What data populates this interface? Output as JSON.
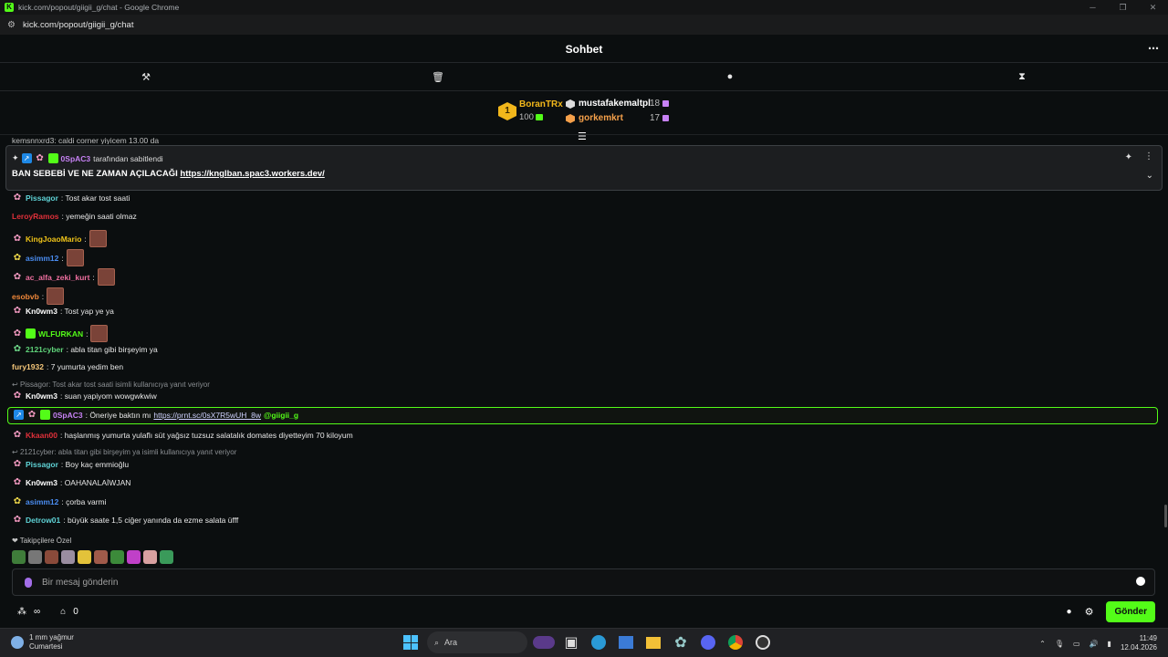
{
  "window": {
    "title": "kick.com/popout/giigii_g/chat - Google Chrome",
    "url": "kick.com/popout/giigii_g/chat",
    "controls": [
      "─",
      "❐",
      "✕"
    ]
  },
  "chat": {
    "title": "Sohbet",
    "more": "⋯"
  },
  "leaderboard": {
    "first": {
      "rank": "1",
      "name": "BoranTRx",
      "value": "100"
    },
    "second": {
      "name": "mustafakemaltpl",
      "value": "18"
    },
    "third": {
      "name": "gorkemkrt",
      "value": "17"
    }
  },
  "pinned": {
    "by_user": "0SpAC3",
    "by_text": "tarafından sabitlendi",
    "text": "BAN SEBEBİ VE NE ZAMAN AÇILACAĞI ",
    "link": "https://knglban.spac3.workers.dev/"
  },
  "messages": [
    {
      "user": "Pissagor",
      "color": "#5fd3d6",
      "text": ": Tost akar tost saati"
    },
    {
      "user": "LeroyRamos",
      "color": "#e0303a",
      "text": ": yemeğin saati olmaz"
    },
    {
      "user": "KingJoaoMario",
      "color": "#f0c419",
      "text": ":"
    },
    {
      "user": "asimm12",
      "color": "#4a8cf0",
      "text": ":"
    },
    {
      "user": "ac_alfa_zeki_kurt",
      "color": "#ef6fa0",
      "text": ":"
    },
    {
      "user": "esobvb",
      "color": "#f0883a",
      "text": ":"
    },
    {
      "user": "Kn0wm3",
      "color": "#ffffff",
      "text": ": Tost yap ye ya"
    },
    {
      "user": "WLFURKAN",
      "color": "#53fc18",
      "text": ":"
    },
    {
      "user": "2121cyber",
      "color": "#5fd37a",
      "text": ": abla titan gibi birşeyim ya"
    },
    {
      "user": "fury1932",
      "color": "#f5c77a",
      "text": ": 7 yumurta yedim ben"
    },
    {
      "user": "Kn0wm3",
      "color": "#ffffff",
      "text": ": suan yapiyom wowgwkwiw"
    },
    {
      "user": "0SpAC3",
      "color": "#c782f5",
      "text": ": Öneriye baktın mı "
    },
    {
      "user": "Kkaan00",
      "color": "#e0303a",
      "text": ": haşlanmış yumurta yulaflı süt yağsız tuzsuz salatalık domates diyetteyim 70 kiloyum"
    },
    {
      "user": "Pissagor",
      "color": "#5fd3d6",
      "text": ": Boy kaç emmioğlu"
    },
    {
      "user": "Kn0wm3",
      "color": "#ffffff",
      "text": ": OAHANALAİWJAN"
    },
    {
      "user": "asimm12",
      "color": "#4a8cf0",
      "text": ": çorba varmi"
    },
    {
      "user": "Detrow01",
      "color": "#5fd3d6",
      "text": ": büyük saate 1,5 ciğer yanında da ezme salata üfff"
    }
  ],
  "highlight": {
    "link": "https://prnt.sc/0sX7R5wUH_8w",
    "mention": "@giigii_g"
  },
  "replies": {
    "r1": "Pissagor: Tost akar tost saati isimli kullanıcıya yanıt veriyor",
    "r2": "2121cyber: abla titan gibi birşeyim ya isimli kullanıcıya yanıt veriyor"
  },
  "topcut": {
    "text": "kemsnnxrd3: caldi corner yiyicem 13.00 da"
  },
  "followers_label": "Takipçilere Özel",
  "input": {
    "placeholder": "Bir mesaj gönderin"
  },
  "footer": {
    "infinity": "∞",
    "count": "0",
    "send": "Gönder"
  },
  "taskbar": {
    "weather_1": "1 mm yağmur",
    "weather_2": "Cumartesi",
    "search": "Ara",
    "time": "11:49",
    "date": "12.04.2026"
  }
}
